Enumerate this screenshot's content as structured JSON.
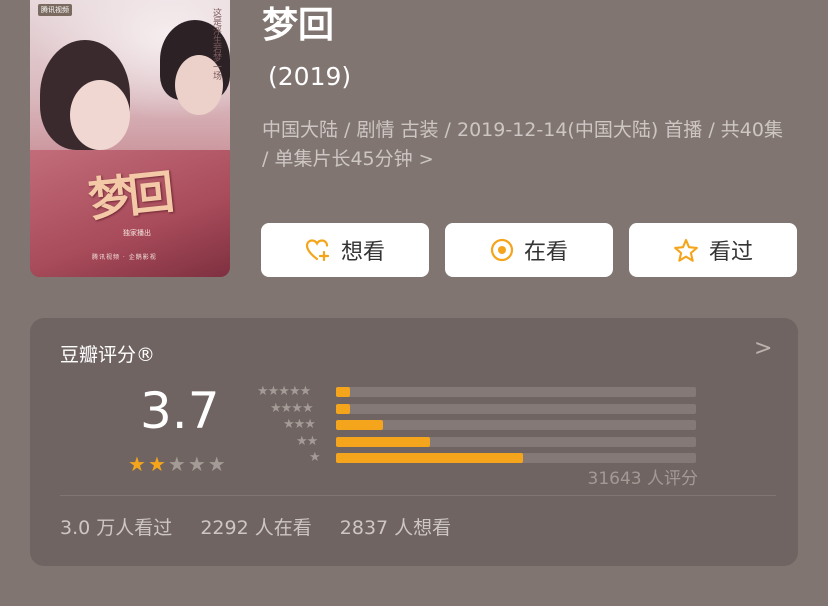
{
  "poster": {
    "brand": "腾讯视频",
    "slogan": "这是浮生若梦一场",
    "title_art": "梦回",
    "tagline": "独家播出",
    "logos": "腾讯视频 · 企鹅影视"
  },
  "movie": {
    "title": "梦回",
    "year": "(2019)",
    "meta_line": "中国大陆 / 剧情 古装 / 2019-12-14(中国大陆) 首播 / 共40集 / 单集片长45分钟",
    "meta_chevron": ">"
  },
  "actions": [
    {
      "label": "想看",
      "icon": "heart-plus-icon"
    },
    {
      "label": "在看",
      "icon": "target-circle-icon"
    },
    {
      "label": "看过",
      "icon": "star-outline-icon"
    }
  ],
  "rating": {
    "title": "豆瓣评分®",
    "arrow": ">",
    "score": "3.7",
    "stars_filled": 2,
    "stars_total": 5,
    "distribution": [
      {
        "stars": 5,
        "fraction": 0.04
      },
      {
        "stars": 4,
        "fraction": 0.04
      },
      {
        "stars": 3,
        "fraction": 0.13
      },
      {
        "stars": 2,
        "fraction": 0.26
      },
      {
        "stars": 1,
        "fraction": 0.52
      }
    ],
    "raters": "31643 人评分",
    "stats": {
      "watched": "3.0 万人看过",
      "watching": "2292 人在看",
      "want": "2837 人想看"
    }
  },
  "colors": {
    "background": "#807571",
    "card": "#6f6461",
    "accent": "#f4a51c"
  }
}
